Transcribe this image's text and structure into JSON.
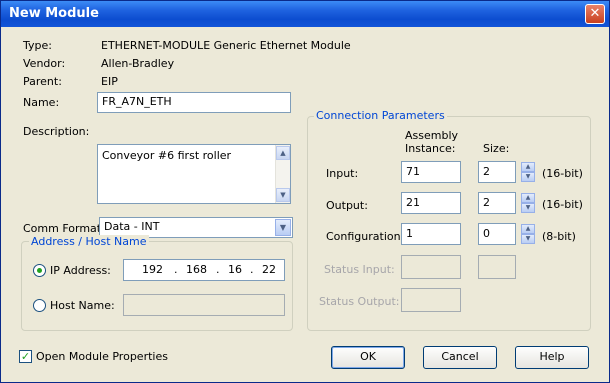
{
  "window": {
    "title": "New Module",
    "close_glyph": "✕"
  },
  "info": {
    "type_label": "Type:",
    "type_value": "ETHERNET-MODULE Generic Ethernet Module",
    "vendor_label": "Vendor:",
    "vendor_value": "Allen-Bradley",
    "parent_label": "Parent:",
    "parent_value": "EIP"
  },
  "name": {
    "label": "Name:",
    "value": "FR_A7N_ETH"
  },
  "description": {
    "label": "Description:",
    "value": "Conveyor #6 first roller"
  },
  "comm_format": {
    "label": "Comm Format:",
    "value": "Data - INT"
  },
  "address": {
    "group_title": "Address / Host Name",
    "ip_label": "IP Address:",
    "ip_octets": [
      "192",
      "168",
      "16",
      "22"
    ],
    "host_label": "Host Name:",
    "host_value": "",
    "selected": "ip"
  },
  "connection": {
    "group_title": "Connection Parameters",
    "col_assembly": "Assembly",
    "col_instance": "Instance:",
    "col_size": "Size:",
    "rows": [
      {
        "label": "Input:",
        "instance": "71",
        "size": "2",
        "unit": "(16-bit)",
        "enabled": true
      },
      {
        "label": "Output:",
        "instance": "21",
        "size": "2",
        "unit": "(16-bit)",
        "enabled": true
      },
      {
        "label": "Configuration:",
        "instance": "1",
        "size": "0",
        "unit": "(8-bit)",
        "enabled": true
      },
      {
        "label": "Status Input:",
        "instance": "",
        "size": "",
        "unit": "",
        "enabled": false
      },
      {
        "label": "Status Output:",
        "instance": "",
        "size": "",
        "unit": "",
        "enabled": false
      }
    ]
  },
  "open_props": {
    "label": "Open Module Properties",
    "checked": true
  },
  "buttons": {
    "ok": "OK",
    "cancel": "Cancel",
    "help": "Help"
  },
  "icons": {
    "up": "▲",
    "down": "▼",
    "check": "✓"
  },
  "colors": {
    "title_bar": "#0c4dd0",
    "group_title": "#0046d5",
    "dialog_bg": "#ece9d8"
  }
}
